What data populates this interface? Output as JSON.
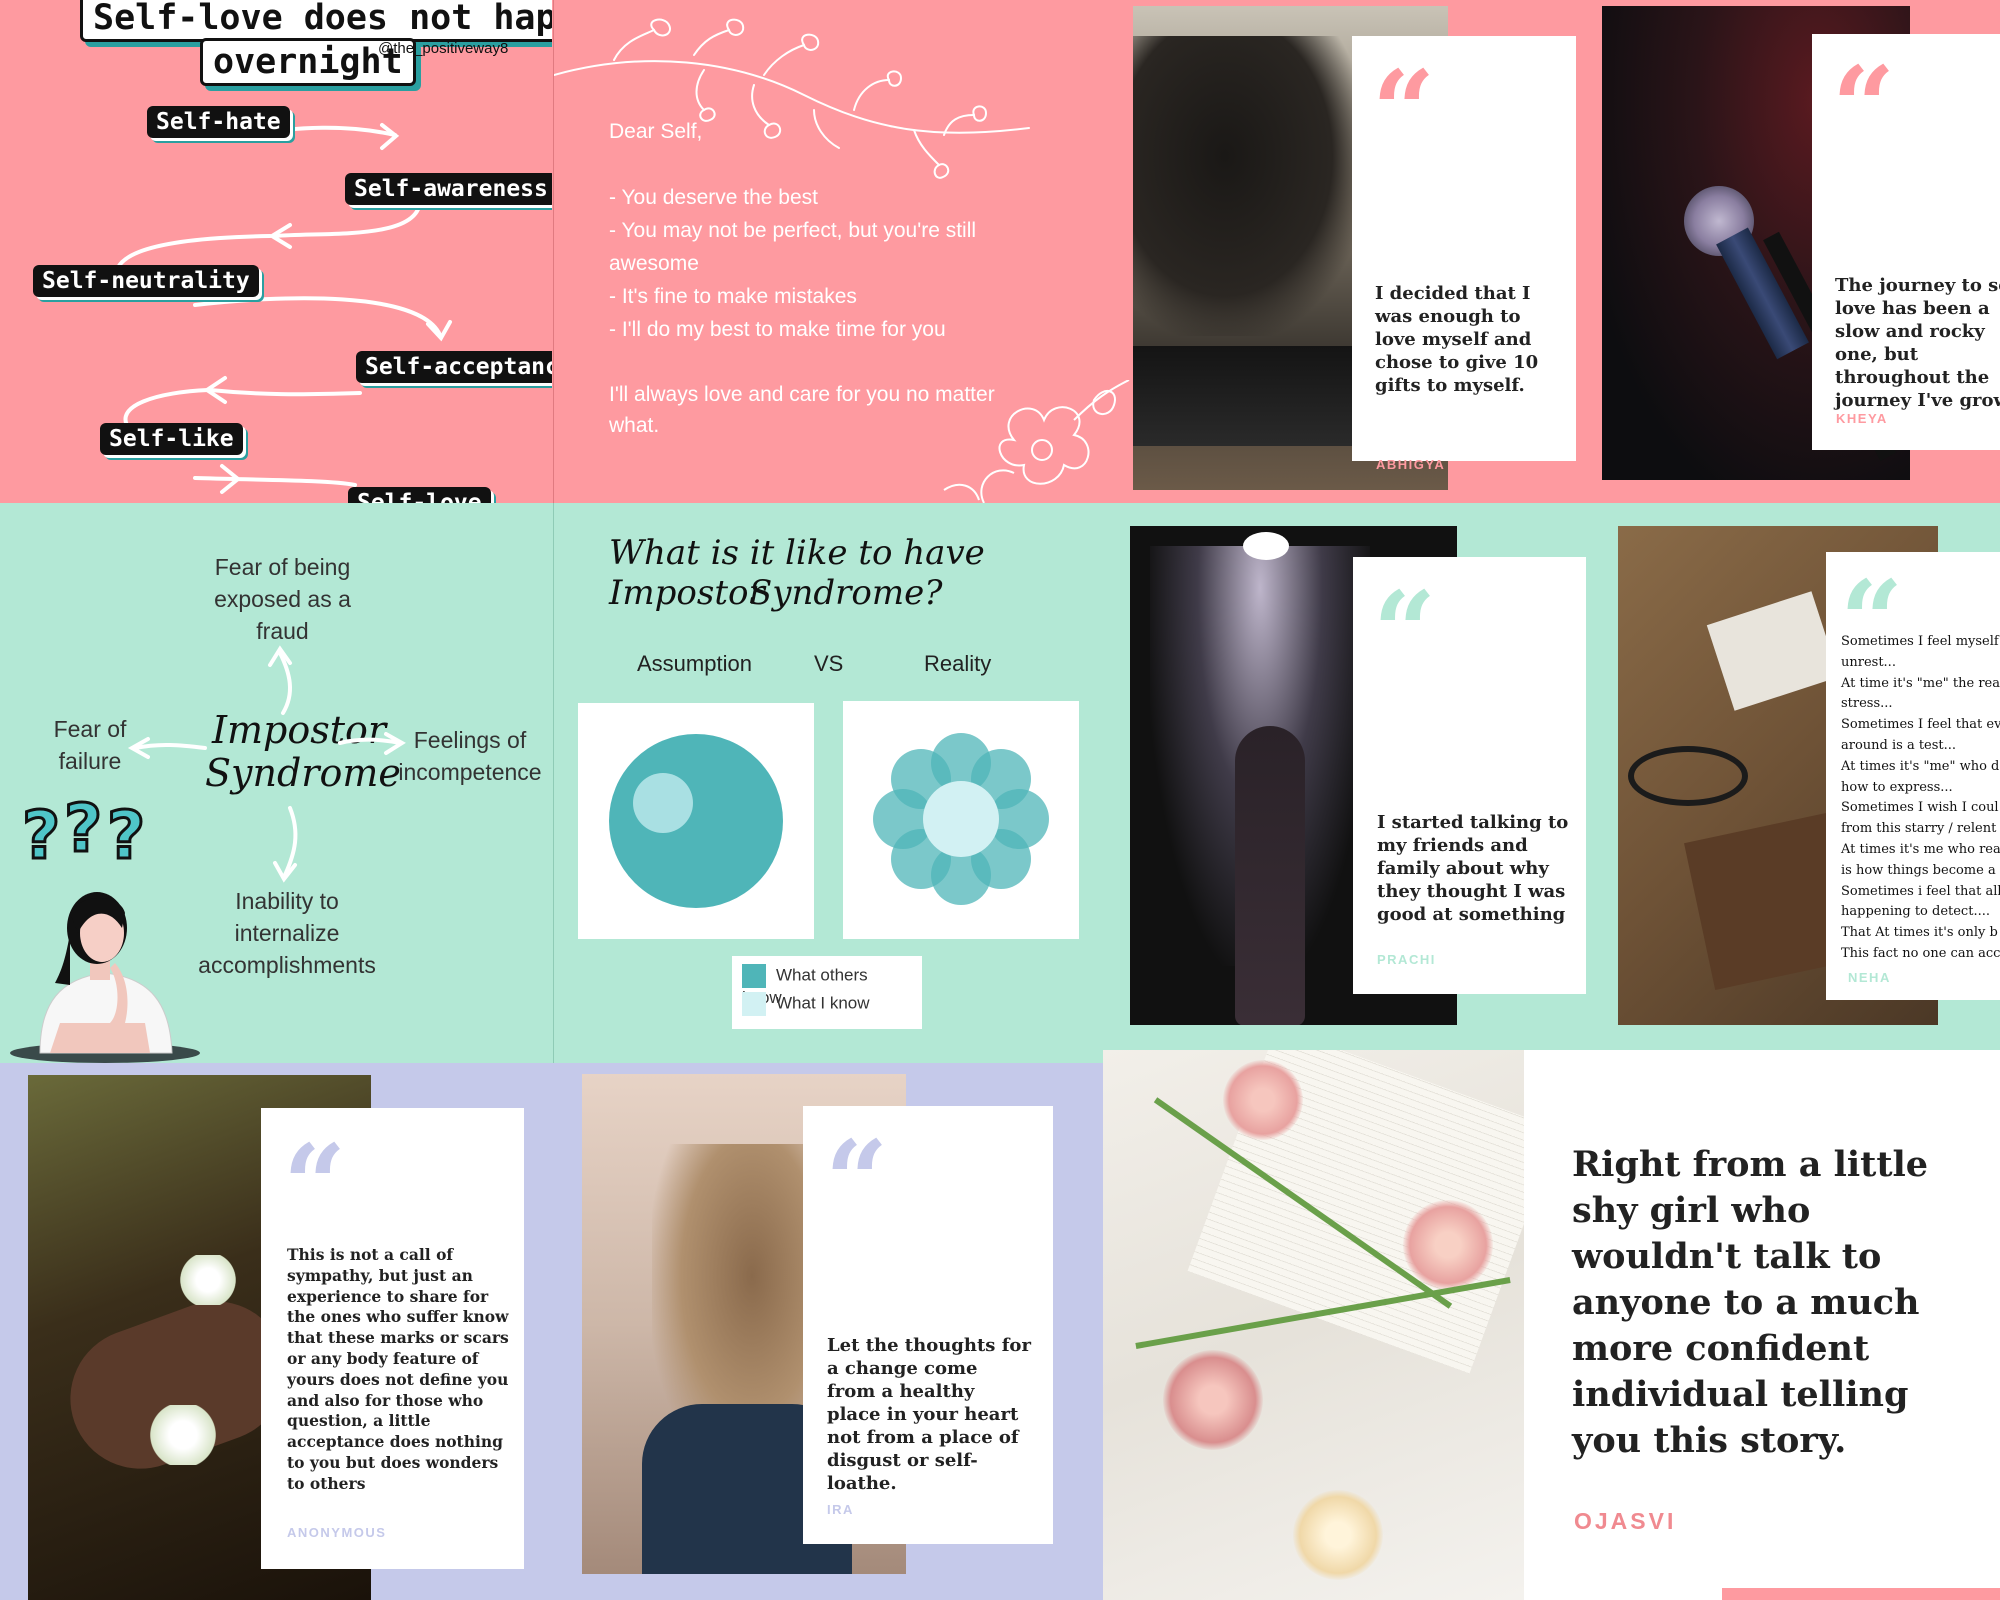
{
  "selflove": {
    "title_line1": "Self-love does not happen",
    "title_line2": "overnight",
    "handle": "@the_positiveway8",
    "steps": [
      "Self-hate",
      "Self-awareness",
      "Self-neutrality",
      "Self-acceptance",
      "Self-like",
      "Self-love"
    ]
  },
  "dear_self": {
    "greeting": "Dear Self,",
    "lines": [
      "- You deserve the best",
      "- You may not be perfect, but you're still",
      "awesome",
      "- It's fine to make mistakes",
      "- I'll do my best to make time for you"
    ],
    "closing_line1": "I'll always love and care for you no matter",
    "closing_line2": "what."
  },
  "quotes": {
    "abhigya": {
      "mark": "“",
      "text": "I decided that I was enough to love myself and chose to give 10 gifts to myself.",
      "author": "ABHIGYA"
    },
    "kheya": {
      "mark": "“",
      "text": "The journey to self love has been a slow and rocky one, but throughout the journey I've grown",
      "author": "KHEYA"
    },
    "prachi": {
      "mark": "“",
      "text": "I started talking to my friends and family about why they thought I was good at something",
      "author": "PRACHI"
    },
    "neha": {
      "mark": "“",
      "lines": [
        "Sometimes I feel myself",
        "unrest...",
        "At time it's \"me\" the rea",
        "stress...",
        "Sometimes I feel that ev",
        "around is a test...",
        "At times it's \"me\" who d",
        "how to express...",
        "Sometimes I wish I coul",
        "from this starry / relent",
        "At times it's me who rea",
        "is how things become a l",
        "Sometimes i feel that all",
        "happening to detect....",
        "That At times it's only b",
        "This fact no one can acc"
      ],
      "author": "NEHA"
    },
    "anonymous": {
      "mark": "“",
      "text": "This is not a call of sympathy, but just an experience to share for the ones who suffer know that these marks or scars or any body feature of yours does not define you and also for those who question, a little acceptance does nothing to you but does wonders to others",
      "author": "ANONYMOUS"
    },
    "ira": {
      "mark": "“",
      "text": "Let the thoughts for a change come from a healthy place in your heart not from a place of disgust or self-loathe.",
      "author": "IRA"
    },
    "ojasvi": {
      "text": "Right from a little shy girl who wouldn't talk to anyone to a much more confident individual telling you this story.",
      "author": "OJASVI"
    }
  },
  "impostor_map": {
    "center_line1": "Impostor",
    "center_line2": "Syndrome",
    "top": [
      "Fear of being",
      "exposed as a",
      "fraud"
    ],
    "left": [
      "Fear of",
      "failure"
    ],
    "right": [
      "Feelings of",
      "incompetence"
    ],
    "bottom": [
      "Inability to",
      "internalize",
      "accomplishments"
    ]
  },
  "impostor_chart": {
    "title_line1": "What is it like to have Impostor",
    "title_line2": "Syndrome?",
    "col_left": "Assumption",
    "col_mid": "VS",
    "col_right": "Reality",
    "legend": [
      "What others know",
      "What I know"
    ],
    "colors": {
      "others": "#4fb5b8",
      "me": "#d2f1f3"
    }
  },
  "colors": {
    "pink": "#fe9aa0",
    "mint": "#b3e8d5",
    "lavender": "#c5c9ea",
    "teal": "#2a9fa0"
  }
}
